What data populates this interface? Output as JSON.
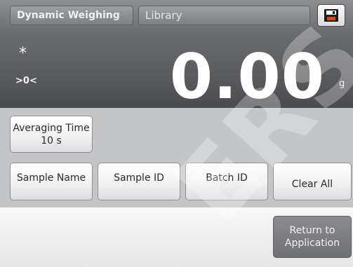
{
  "header": {
    "app_tab": "Dynamic Weighing",
    "library_tab": "Library",
    "save_icon": "save-icon"
  },
  "display": {
    "stable_indicator": "*",
    "zero_indicator": ">0<",
    "weight_value": "0.00",
    "unit": "g"
  },
  "buttons": {
    "averaging_time_label": "Averaging Time",
    "averaging_time_value": "10 s",
    "sample_name": "Sample Name",
    "sample_id": "Sample ID",
    "batch_id": "Batch ID",
    "clear_all": "Clear All",
    "return_line1": "Return to",
    "return_line2": "Application"
  },
  "watermark": "ERS",
  "colors": {
    "display_background": "#5a5c5f",
    "button_background": "#f1f1f2",
    "return_button_background": "#7c7e82"
  }
}
